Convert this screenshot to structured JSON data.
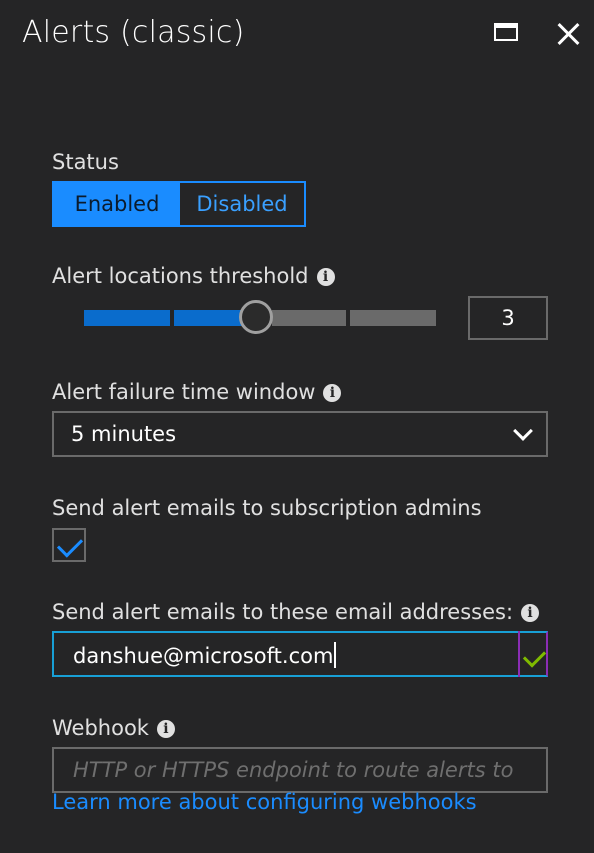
{
  "window": {
    "title": "Alerts (classic)"
  },
  "status": {
    "label": "Status",
    "options": [
      "Enabled",
      "Disabled"
    ],
    "selected": "Enabled"
  },
  "threshold": {
    "label": "Alert locations threshold",
    "value": "3",
    "min": 1,
    "max": 5,
    "steps": 4
  },
  "time_window": {
    "label": "Alert failure time window",
    "selected": "5 minutes"
  },
  "admins": {
    "label": "Send alert emails to subscription admins",
    "checked": true
  },
  "emails": {
    "label": "Send alert emails to these email addresses:",
    "value": "danshue@microsoft.com"
  },
  "webhook": {
    "label": "Webhook",
    "placeholder": "HTTP or HTTPS endpoint to route alerts to",
    "link": "Learn more about configuring webhooks"
  },
  "colors": {
    "accent": "#1a8cff",
    "valid": "#7fba00",
    "background": "#252526"
  }
}
